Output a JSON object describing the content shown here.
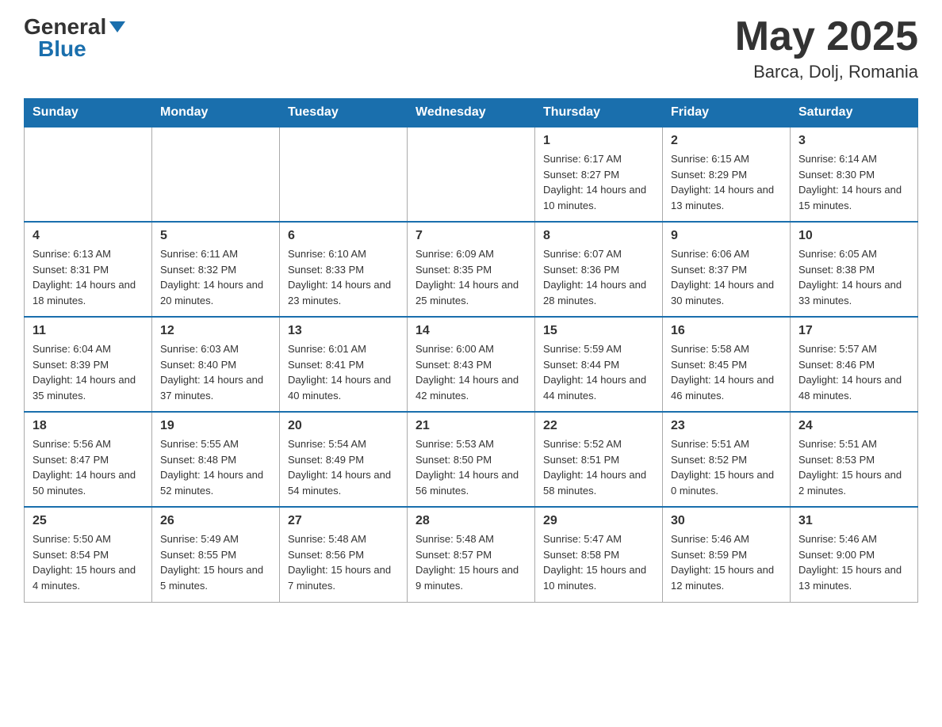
{
  "header": {
    "logo_general": "General",
    "logo_blue": "Blue",
    "month_title": "May 2025",
    "location": "Barca, Dolj, Romania"
  },
  "days_of_week": [
    "Sunday",
    "Monday",
    "Tuesday",
    "Wednesday",
    "Thursday",
    "Friday",
    "Saturday"
  ],
  "weeks": [
    [
      {
        "day": "",
        "info": ""
      },
      {
        "day": "",
        "info": ""
      },
      {
        "day": "",
        "info": ""
      },
      {
        "day": "",
        "info": ""
      },
      {
        "day": "1",
        "info": "Sunrise: 6:17 AM\nSunset: 8:27 PM\nDaylight: 14 hours and 10 minutes."
      },
      {
        "day": "2",
        "info": "Sunrise: 6:15 AM\nSunset: 8:29 PM\nDaylight: 14 hours and 13 minutes."
      },
      {
        "day": "3",
        "info": "Sunrise: 6:14 AM\nSunset: 8:30 PM\nDaylight: 14 hours and 15 minutes."
      }
    ],
    [
      {
        "day": "4",
        "info": "Sunrise: 6:13 AM\nSunset: 8:31 PM\nDaylight: 14 hours and 18 minutes."
      },
      {
        "day": "5",
        "info": "Sunrise: 6:11 AM\nSunset: 8:32 PM\nDaylight: 14 hours and 20 minutes."
      },
      {
        "day": "6",
        "info": "Sunrise: 6:10 AM\nSunset: 8:33 PM\nDaylight: 14 hours and 23 minutes."
      },
      {
        "day": "7",
        "info": "Sunrise: 6:09 AM\nSunset: 8:35 PM\nDaylight: 14 hours and 25 minutes."
      },
      {
        "day": "8",
        "info": "Sunrise: 6:07 AM\nSunset: 8:36 PM\nDaylight: 14 hours and 28 minutes."
      },
      {
        "day": "9",
        "info": "Sunrise: 6:06 AM\nSunset: 8:37 PM\nDaylight: 14 hours and 30 minutes."
      },
      {
        "day": "10",
        "info": "Sunrise: 6:05 AM\nSunset: 8:38 PM\nDaylight: 14 hours and 33 minutes."
      }
    ],
    [
      {
        "day": "11",
        "info": "Sunrise: 6:04 AM\nSunset: 8:39 PM\nDaylight: 14 hours and 35 minutes."
      },
      {
        "day": "12",
        "info": "Sunrise: 6:03 AM\nSunset: 8:40 PM\nDaylight: 14 hours and 37 minutes."
      },
      {
        "day": "13",
        "info": "Sunrise: 6:01 AM\nSunset: 8:41 PM\nDaylight: 14 hours and 40 minutes."
      },
      {
        "day": "14",
        "info": "Sunrise: 6:00 AM\nSunset: 8:43 PM\nDaylight: 14 hours and 42 minutes."
      },
      {
        "day": "15",
        "info": "Sunrise: 5:59 AM\nSunset: 8:44 PM\nDaylight: 14 hours and 44 minutes."
      },
      {
        "day": "16",
        "info": "Sunrise: 5:58 AM\nSunset: 8:45 PM\nDaylight: 14 hours and 46 minutes."
      },
      {
        "day": "17",
        "info": "Sunrise: 5:57 AM\nSunset: 8:46 PM\nDaylight: 14 hours and 48 minutes."
      }
    ],
    [
      {
        "day": "18",
        "info": "Sunrise: 5:56 AM\nSunset: 8:47 PM\nDaylight: 14 hours and 50 minutes."
      },
      {
        "day": "19",
        "info": "Sunrise: 5:55 AM\nSunset: 8:48 PM\nDaylight: 14 hours and 52 minutes."
      },
      {
        "day": "20",
        "info": "Sunrise: 5:54 AM\nSunset: 8:49 PM\nDaylight: 14 hours and 54 minutes."
      },
      {
        "day": "21",
        "info": "Sunrise: 5:53 AM\nSunset: 8:50 PM\nDaylight: 14 hours and 56 minutes."
      },
      {
        "day": "22",
        "info": "Sunrise: 5:52 AM\nSunset: 8:51 PM\nDaylight: 14 hours and 58 minutes."
      },
      {
        "day": "23",
        "info": "Sunrise: 5:51 AM\nSunset: 8:52 PM\nDaylight: 15 hours and 0 minutes."
      },
      {
        "day": "24",
        "info": "Sunrise: 5:51 AM\nSunset: 8:53 PM\nDaylight: 15 hours and 2 minutes."
      }
    ],
    [
      {
        "day": "25",
        "info": "Sunrise: 5:50 AM\nSunset: 8:54 PM\nDaylight: 15 hours and 4 minutes."
      },
      {
        "day": "26",
        "info": "Sunrise: 5:49 AM\nSunset: 8:55 PM\nDaylight: 15 hours and 5 minutes."
      },
      {
        "day": "27",
        "info": "Sunrise: 5:48 AM\nSunset: 8:56 PM\nDaylight: 15 hours and 7 minutes."
      },
      {
        "day": "28",
        "info": "Sunrise: 5:48 AM\nSunset: 8:57 PM\nDaylight: 15 hours and 9 minutes."
      },
      {
        "day": "29",
        "info": "Sunrise: 5:47 AM\nSunset: 8:58 PM\nDaylight: 15 hours and 10 minutes."
      },
      {
        "day": "30",
        "info": "Sunrise: 5:46 AM\nSunset: 8:59 PM\nDaylight: 15 hours and 12 minutes."
      },
      {
        "day": "31",
        "info": "Sunrise: 5:46 AM\nSunset: 9:00 PM\nDaylight: 15 hours and 13 minutes."
      }
    ]
  ]
}
